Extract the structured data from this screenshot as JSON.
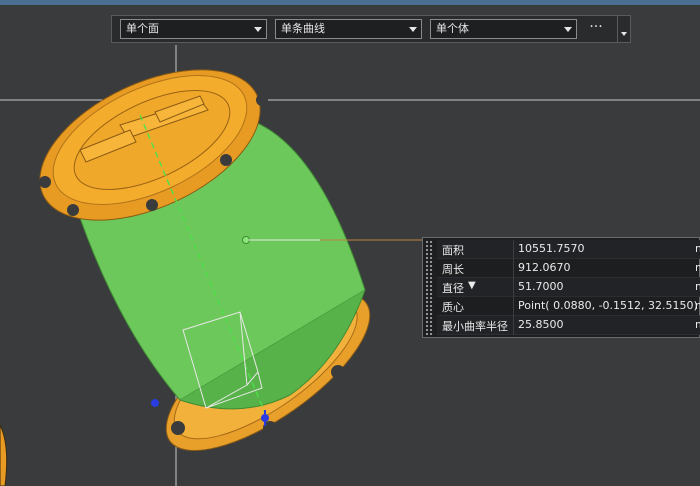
{
  "toolbar": {
    "face_filter": "单个面",
    "curve_filter": "单条曲线",
    "body_filter": "单个体",
    "more_label": "···"
  },
  "measure": {
    "rows": [
      {
        "label": "面积",
        "value": "10551.7570",
        "unit": "m"
      },
      {
        "label": "周长",
        "value": "912.0670",
        "unit": "m"
      },
      {
        "label": "直径",
        "value": "51.7000",
        "unit": "m",
        "dropdown": "▼"
      },
      {
        "label": "质心",
        "value": "Point( 0.0880, -0.1512, 32.5150)",
        "unit": "m"
      },
      {
        "label": "最小曲率半径",
        "value": "25.8500",
        "unit": "m"
      }
    ]
  },
  "colors": {
    "background": "#3a3b3d",
    "part_orange": "#f1a52a",
    "selected_face_green": "#6cc85a",
    "leader_line": "#c08040"
  },
  "icons": [
    "dropdown-arrow-icon",
    "more-options-icon",
    "panel-grip-icon",
    "axis-triad-icon"
  ]
}
